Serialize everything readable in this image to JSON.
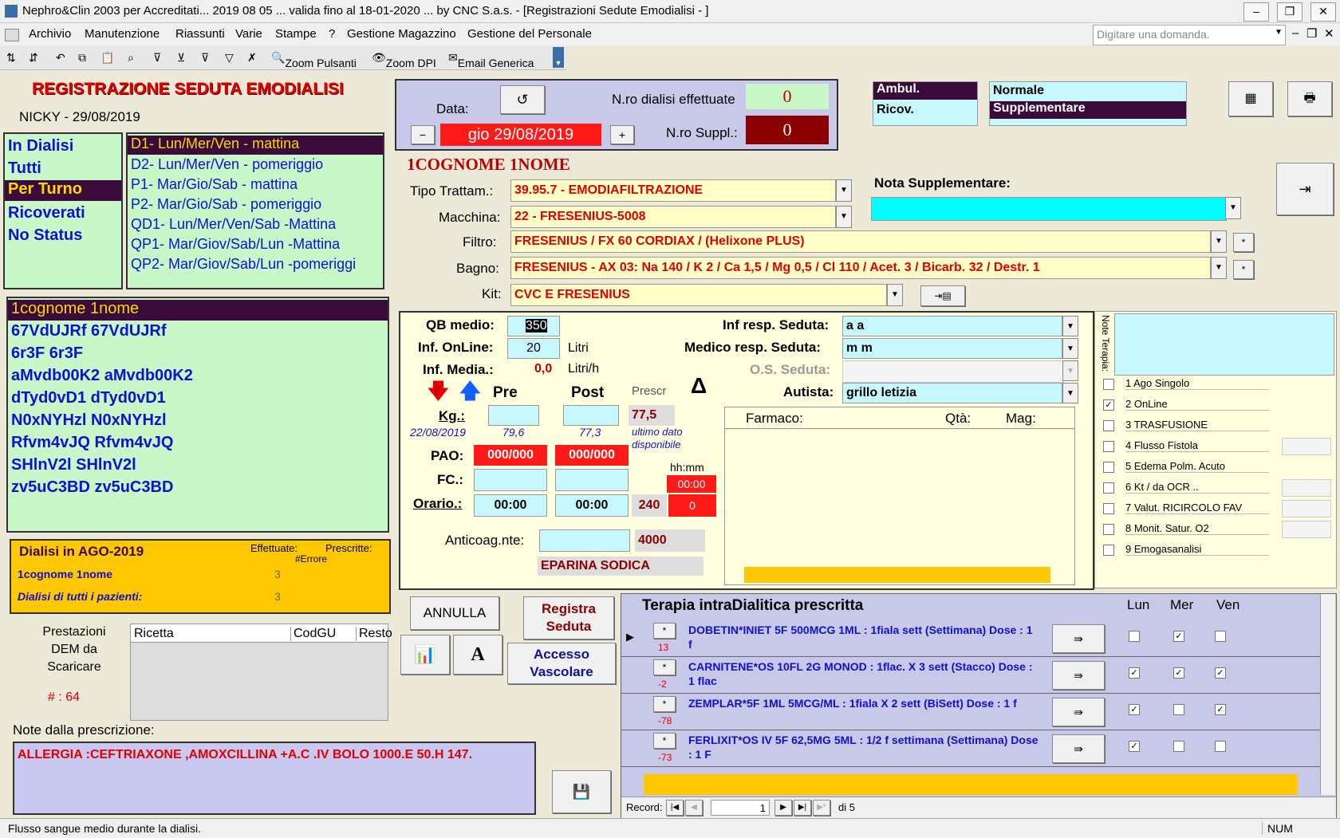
{
  "window": {
    "title": "Nephro&Clin 2003 per Accreditati... 2019 08 05 ... valida fino al 18-01-2020 ... by CNC S.a.s. - [Registrazioni Sedute Emodialisi - ]"
  },
  "menu": [
    "Archivio",
    "Manutenzione",
    "Riassunti",
    "Varie",
    "Stampe",
    "?",
    "Gestione Magazzino",
    "Gestione del Personale"
  ],
  "search": {
    "placeholder": "Digitare una domanda."
  },
  "toolbar": {
    "zoom_pulsanti": "Zoom Pulsanti",
    "zoom_dpi": "Zoom DPI",
    "email": "Email Generica"
  },
  "form_title": "REGISTRAZIONE SEDUTA EMODIALISI",
  "user_date": "NICKY - 29/08/2019",
  "filters": [
    "In Dialisi",
    "Tutti",
    "Per Turno",
    "Ricoverati",
    "No Status"
  ],
  "shifts": [
    "D1- Lun/Mer/Ven - mattina",
    "D2- Lun/Mer/Ven - pomeriggio",
    "P1- Mar/Gio/Sab - mattina",
    "P2- Mar/Gio/Sab - pomeriggio",
    "QD1- Lun/Mer/Ven/Sab -Mattina",
    "QP1- Mar/Giov/Sab/Lun -Mattina",
    "QP2- Mar/Giov/Sab/Lun -pomeriggi"
  ],
  "patients": [
    "1cognome 1nome",
    "67VdUJRf 67VdUJRf",
    "6r3F 6r3F",
    "aMvdb00K2 aMvdb00K2",
    "dTyd0vD1 dTyd0vD1",
    "N0xNYHzl N0xNYHzl",
    "Rfvm4vJQ Rfvm4vJQ",
    "SHlnV2l SHlnV2l",
    "zv5uC3BD zv5uC3BD"
  ],
  "dialysis_summary": {
    "title": "Dialisi in AGO-2019",
    "col_done": "Effettuate:",
    "col_prescribed": "Prescritte:",
    "error": "#Errore",
    "row1_label": "1cognome 1nome",
    "row1_done": "3",
    "row2_label": "Dialisi di tutti i pazienti:",
    "row2_done": "3"
  },
  "dem": {
    "label": "Prestazioni DEM da Scaricare",
    "count": "# : 64",
    "cols": [
      "Ricetta",
      "CodGU",
      "Resto"
    ]
  },
  "prescription_notes": {
    "label": "Note dalla prescrizione:",
    "text": "ALLERGIA :CEFTRIAXONE ,AMOXCILLINA +A.C .IV BOLO 1000.E 50.H 147."
  },
  "session": {
    "data_label": "Data:",
    "date": "gio 29/08/2019",
    "minus": "−",
    "plus": "+",
    "n_dialisi_label": "N.ro dialisi effettuate",
    "n_dialisi": "0",
    "n_suppl_label": "N.ro Suppl.:",
    "n_suppl": "0"
  },
  "status_box": {
    "ambul": "Ambul.",
    "ricov": "Ricov.",
    "normale": "Normale",
    "supplementare": "Supplementare"
  },
  "patient_name": "1COGNOME 1NOME",
  "fields": {
    "tipo_label": "Tipo Trattam.:",
    "tipo": "39.95.7 - EMODIAFILTRAZIONE",
    "macchina_label": "Macchina:",
    "macchina": "22 - FRESENIUS-5008",
    "filtro_label": "Filtro:",
    "filtro": "FRESENIUS    /   FX 60 CORDIAX  /    (Helixone PLUS)",
    "bagno_label": "Bagno:",
    "bagno": "FRESENIUS - AX 03: Na 140 / K 2 / Ca 1,5 / Mg 0,5 / Cl 110 / Acet. 3 /  Bicarb. 32 / Destr. 1",
    "kit_label": "Kit:",
    "kit": "CVC  E  FRESENIUS",
    "nota_suppl_label": "Nota Supplementare:"
  },
  "params": {
    "qb_label": "QB medio:",
    "qb": "350",
    "inf_online_label": "Inf. OnLine:",
    "inf_online": "20",
    "litri": "Litri",
    "inf_media_label": "Inf. Media.:",
    "inf_media": "0,0",
    "litri_h": "Litri/h",
    "pre": "Pre",
    "post": "Post",
    "prescr": "Prescr",
    "kg_label": "Kg.:",
    "kg_prescr": "77,5",
    "prev_date": "22/08/2019",
    "prev_pre": "79,6",
    "prev_post": "77,3",
    "ultimo_dato": "ultimo dato disponibile",
    "pao_label": "PAO:",
    "pao_pre": "000/000",
    "pao_post": "000/000",
    "fc_label": "FC.:",
    "hhmm": "hh:mm",
    "hhmm_val": "00:00",
    "orario_label": "Orario.:",
    "orario_pre": "00:00",
    "orario_post": "00:00",
    "minutes": "240",
    "minutes_diff": "0",
    "anticoag_label": "Anticoag.nte:",
    "anticoag_val": "4000",
    "eparina": "EPARINA SODICA",
    "delta": "Δ"
  },
  "staff": {
    "inf_resp_label": "Inf resp. Seduta:",
    "inf_resp": "a a",
    "medico_label": "Medico  resp. Seduta:",
    "medico": "m m",
    "os_label": "O.S. Seduta:",
    "autista_label": "Autista:",
    "autista": "grillo letizia"
  },
  "farmaco": {
    "farmaco": "Farmaco:",
    "qta": "Qtà:",
    "mag": "Mag:"
  },
  "note_terapia_label": "Note Terapia:",
  "checklist": [
    {
      "label": "1 Ago Singolo",
      "checked": false
    },
    {
      "label": "2 OnLine",
      "checked": true
    },
    {
      "label": "3 TRASFUSIONE",
      "checked": false
    },
    {
      "label": "4 Flusso Fistola",
      "checked": false
    },
    {
      "label": "5 Edema Polm. Acuto",
      "checked": false
    },
    {
      "label": "6 Kt / da OCR ..",
      "checked": false
    },
    {
      "label": "7 Valut. RICIRCOLO FAV",
      "checked": false
    },
    {
      "label": "8 Monit. Satur. O2",
      "checked": false
    },
    {
      "label": "9 Emogasanalisi",
      "checked": false
    }
  ],
  "buttons": {
    "annulla": "ANNULLA",
    "registra": "Registra Seduta",
    "accesso": "Accesso Vascolare",
    "font_a": "A"
  },
  "therapy": {
    "title": "Terapia intraDialitica prescritta",
    "days": [
      "Lun",
      "Mer",
      "Ven"
    ],
    "rows": [
      {
        "num": "13",
        "text": "DOBETIN*INIET 5F 500MCG 1ML : 1fiala sett  (Settimana) Dose : 1  f",
        "checks": [
          false,
          true,
          false
        ]
      },
      {
        "num": "-2",
        "text": "CARNITENE*OS 10FL 2G MONOD : 1flac. X 3 sett  (Stacco) Dose : 1  flac",
        "checks": [
          true,
          true,
          true
        ]
      },
      {
        "num": "-78",
        "text": "ZEMPLAR*5F 1ML 5MCG/ML : 1fiala X 2 sett  (BiSett) Dose : 1  f",
        "checks": [
          true,
          false,
          true
        ]
      },
      {
        "num": "-73",
        "text": "FERLIXIT*OS IV 5F 62,5MG 5ML : 1/2 f  settimana  (Settimana) Dose : 1  F",
        "checks": [
          true,
          false,
          false
        ]
      }
    ],
    "record_label": "Record:",
    "record_value": "1",
    "record_total": "di 5"
  },
  "status": {
    "text": "Flusso sangue medio durante la dialisi.",
    "num": "NUM"
  },
  "colors": {
    "panel_green": "#C8F7C8",
    "accent_red": "#E00000",
    "dark_purple": "#3A0A3A",
    "yellow": "#FFC800"
  }
}
